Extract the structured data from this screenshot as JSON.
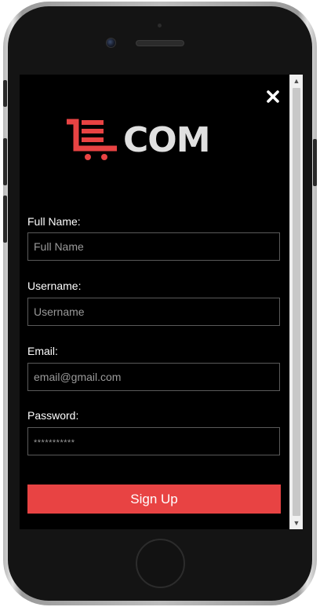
{
  "app": {
    "logo_text": "COM",
    "brand_color": "#e84343"
  },
  "form": {
    "full_name": {
      "label": "Full Name:",
      "placeholder": "Full Name",
      "value": ""
    },
    "username": {
      "label": "Username:",
      "placeholder": "Username",
      "value": ""
    },
    "email": {
      "label": "Email:",
      "placeholder": "email@gmail.com",
      "value": ""
    },
    "password": {
      "label": "Password:",
      "placeholder": "***********",
      "value": ""
    },
    "submit_label": "Sign Up"
  },
  "icons": {
    "close": "close-icon",
    "logo": "cart-logo-icon"
  }
}
